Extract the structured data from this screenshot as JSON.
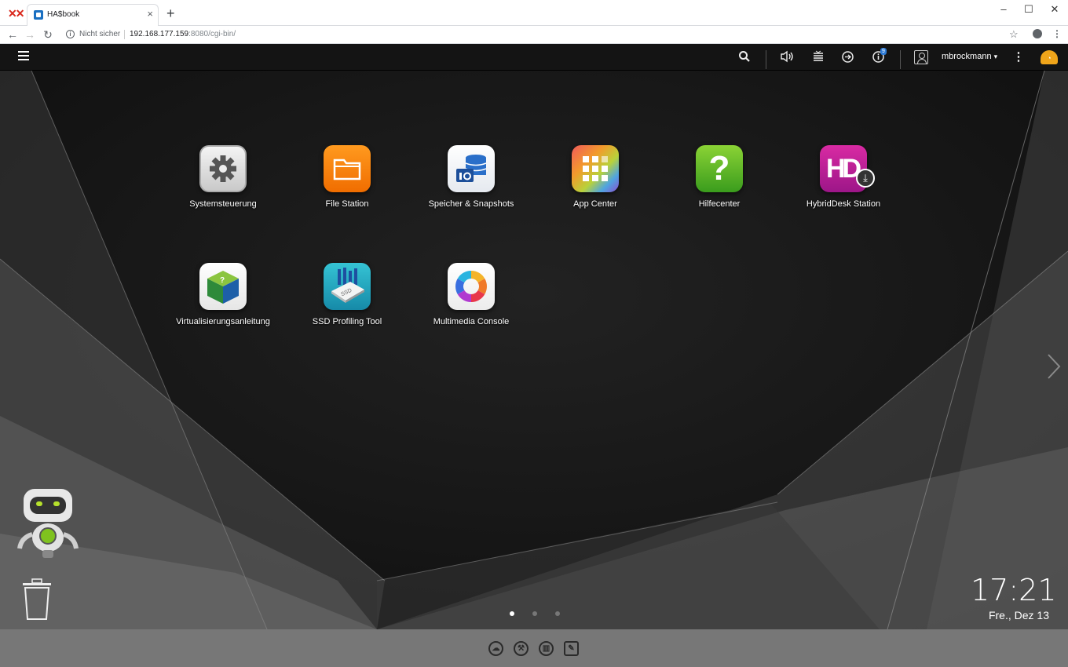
{
  "browser": {
    "tab_title": "HA$book",
    "tab_close": "×",
    "new_tab": "+",
    "not_secure": "Nicht sicher",
    "url_host": "192.168.177.159",
    "url_rest": ":8080/cgi-bin/",
    "window_controls": [
      "–",
      "☐",
      "✕"
    ]
  },
  "topbar": {
    "username": "mbrockmann",
    "username_caret": "▾",
    "notification_count": "9",
    "icons": [
      "menu-icon",
      "search-icon",
      "volume-icon",
      "stack-icon",
      "sync-icon",
      "info-icon",
      "user-icon",
      "more-icon",
      "dashboard-gauge-icon"
    ]
  },
  "apps": [
    {
      "label": "Systemsteuerung",
      "icon": "gear-icon"
    },
    {
      "label": "File Station",
      "icon": "folder-icon"
    },
    {
      "label": "Speicher & Snapshots",
      "icon": "storage-icon"
    },
    {
      "label": "App Center",
      "icon": "app-grid-icon"
    },
    {
      "label": "Hilfecenter",
      "icon": "question-icon"
    },
    {
      "label": "HybridDesk Station",
      "icon": "hd-icon"
    },
    {
      "label": "Virtualisierungsanleitung",
      "icon": "cube-icon"
    },
    {
      "label": "SSD Profiling Tool",
      "icon": "ssd-icon"
    },
    {
      "label": "Multimedia Console",
      "icon": "multimedia-icon"
    }
  ],
  "hd_letters": "HD",
  "ssd_text": "SSD",
  "help_mark": "?",
  "clock": {
    "time": "17:21",
    "date": "Fre., Dez 13"
  },
  "pagination": {
    "pages": 3,
    "current": 1
  },
  "dock": [
    "cloud-icon",
    "tools-icon",
    "columns-icon",
    "edit-icon"
  ],
  "colors": {
    "accent": "#2e7bd6",
    "gauge": "#f0a51a",
    "desktop_bg": "#1b1b1b"
  }
}
